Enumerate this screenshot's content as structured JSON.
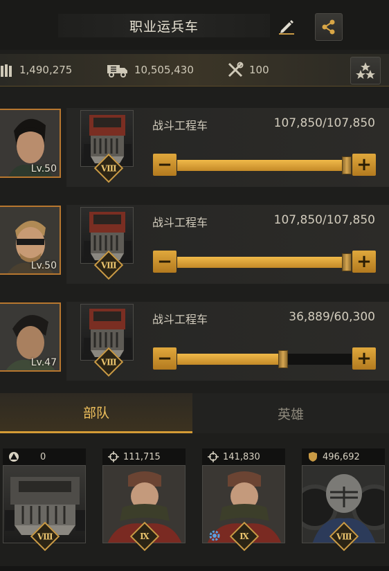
{
  "header": {
    "title": "职业运兵车",
    "edit_icon": "pencil-icon",
    "share_icon": "share-nodes-icon"
  },
  "resources": [
    {
      "icon": "ammo-icon",
      "value": "1,490,275"
    },
    {
      "icon": "truck-icon",
      "value": "10,505,430"
    },
    {
      "icon": "wrench-cross-icon",
      "value": "100"
    }
  ],
  "squads": [
    {
      "hero_level": "Lv.50",
      "unit_name": "战斗工程车",
      "unit_count": "107,850/107,850",
      "fill_fraction": 1.0,
      "rank": "Ⅷ"
    },
    {
      "hero_level": "Lv.50",
      "unit_name": "战斗工程车",
      "unit_count": "107,850/107,850",
      "fill_fraction": 1.0,
      "rank": "Ⅷ"
    },
    {
      "hero_level": "Lv.47",
      "unit_name": "战斗工程车",
      "unit_count": "36,889/60,300",
      "fill_fraction": 0.612,
      "rank": "Ⅷ"
    }
  ],
  "tabs": {
    "troops": "部队",
    "heroes": "英雄"
  },
  "cards": [
    {
      "stat_icon": "triangle-circle-icon",
      "value": "0",
      "rank": "Ⅷ"
    },
    {
      "stat_icon": "crosshair-icon",
      "value": "111,715",
      "rank": "Ⅸ"
    },
    {
      "stat_icon": "crosshair-icon",
      "value": "141,830",
      "rank": "Ⅸ"
    },
    {
      "stat_icon": "shield-icon",
      "value": "496,692",
      "rank": "Ⅷ"
    }
  ],
  "colors": {
    "accent": "#d49b35",
    "slider_fill": "#e0a83c",
    "bg": "#1e1e1c"
  }
}
